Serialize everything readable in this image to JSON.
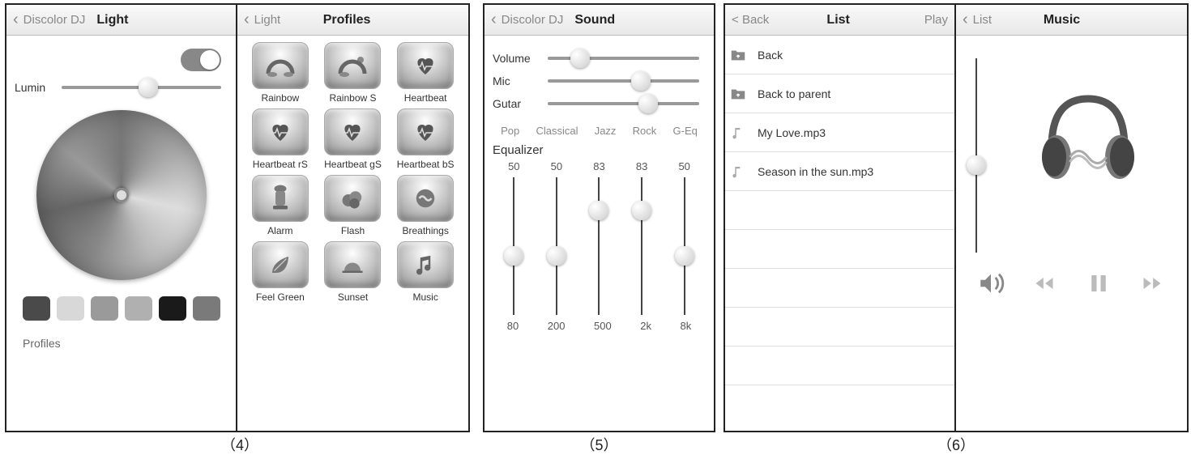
{
  "screen_light": {
    "back": "Discolor DJ",
    "title": "Light",
    "toggle_on": true,
    "lumin_label": "Lumin",
    "lumin_value": 50,
    "swatch_colors": [
      "#4a4a4a",
      "#d8d8d8",
      "#9a9a9a",
      "#b0b0b0",
      "#1a1a1a",
      "#7a7a7a"
    ],
    "profiles_link": "Profiles"
  },
  "screen_profiles": {
    "back": "Light",
    "title": "Profiles",
    "items": [
      {
        "label": "Rainbow",
        "icon": "rainbow"
      },
      {
        "label": "Rainbow S",
        "icon": "rainbow-sun"
      },
      {
        "label": "Heartbeat",
        "icon": "heartbeat"
      },
      {
        "label": "Heartbeat rS",
        "icon": "heartbeat"
      },
      {
        "label": "Heartbeat gS",
        "icon": "heartbeat"
      },
      {
        "label": "Heartbeat bS",
        "icon": "heartbeat"
      },
      {
        "label": "Alarm",
        "icon": "alarm"
      },
      {
        "label": "Flash",
        "icon": "flash"
      },
      {
        "label": "Breathings",
        "icon": "breathing"
      },
      {
        "label": "Feel Green",
        "icon": "leaf"
      },
      {
        "label": "Sunset",
        "icon": "sunset"
      },
      {
        "label": "Music",
        "icon": "music"
      }
    ]
  },
  "screen_sound": {
    "back": "Discolor DJ",
    "title": "Sound",
    "sliders": [
      {
        "label": "Volume",
        "value": 15
      },
      {
        "label": "Mic",
        "value": 55
      },
      {
        "label": "Gutar",
        "value": 60
      }
    ],
    "eq_presets": [
      "Pop",
      "Classical",
      "Jazz",
      "Rock",
      "G-Eq"
    ],
    "eq_title": "Equalizer",
    "eq_bands": [
      {
        "freq": "80",
        "value": 50
      },
      {
        "freq": "200",
        "value": 50
      },
      {
        "freq": "500",
        "value": 83
      },
      {
        "freq": "2k",
        "value": 83
      },
      {
        "freq": "8k",
        "value": 50
      }
    ]
  },
  "screen_list": {
    "back": "Back",
    "title": "List",
    "right": "Play",
    "items": [
      {
        "label": "Back",
        "icon": "folder-up"
      },
      {
        "label": "Back to parent",
        "icon": "folder-up"
      },
      {
        "label": "My Love.mp3",
        "icon": "music-note"
      },
      {
        "label": "Season in the sun.mp3",
        "icon": "music-note"
      }
    ]
  },
  "screen_music": {
    "back": "List",
    "title": "Music",
    "volume": 50,
    "controls": [
      "speaker",
      "prev",
      "pause",
      "next"
    ]
  },
  "figure_labels": [
    "（4）",
    "（5）",
    "（6）"
  ]
}
